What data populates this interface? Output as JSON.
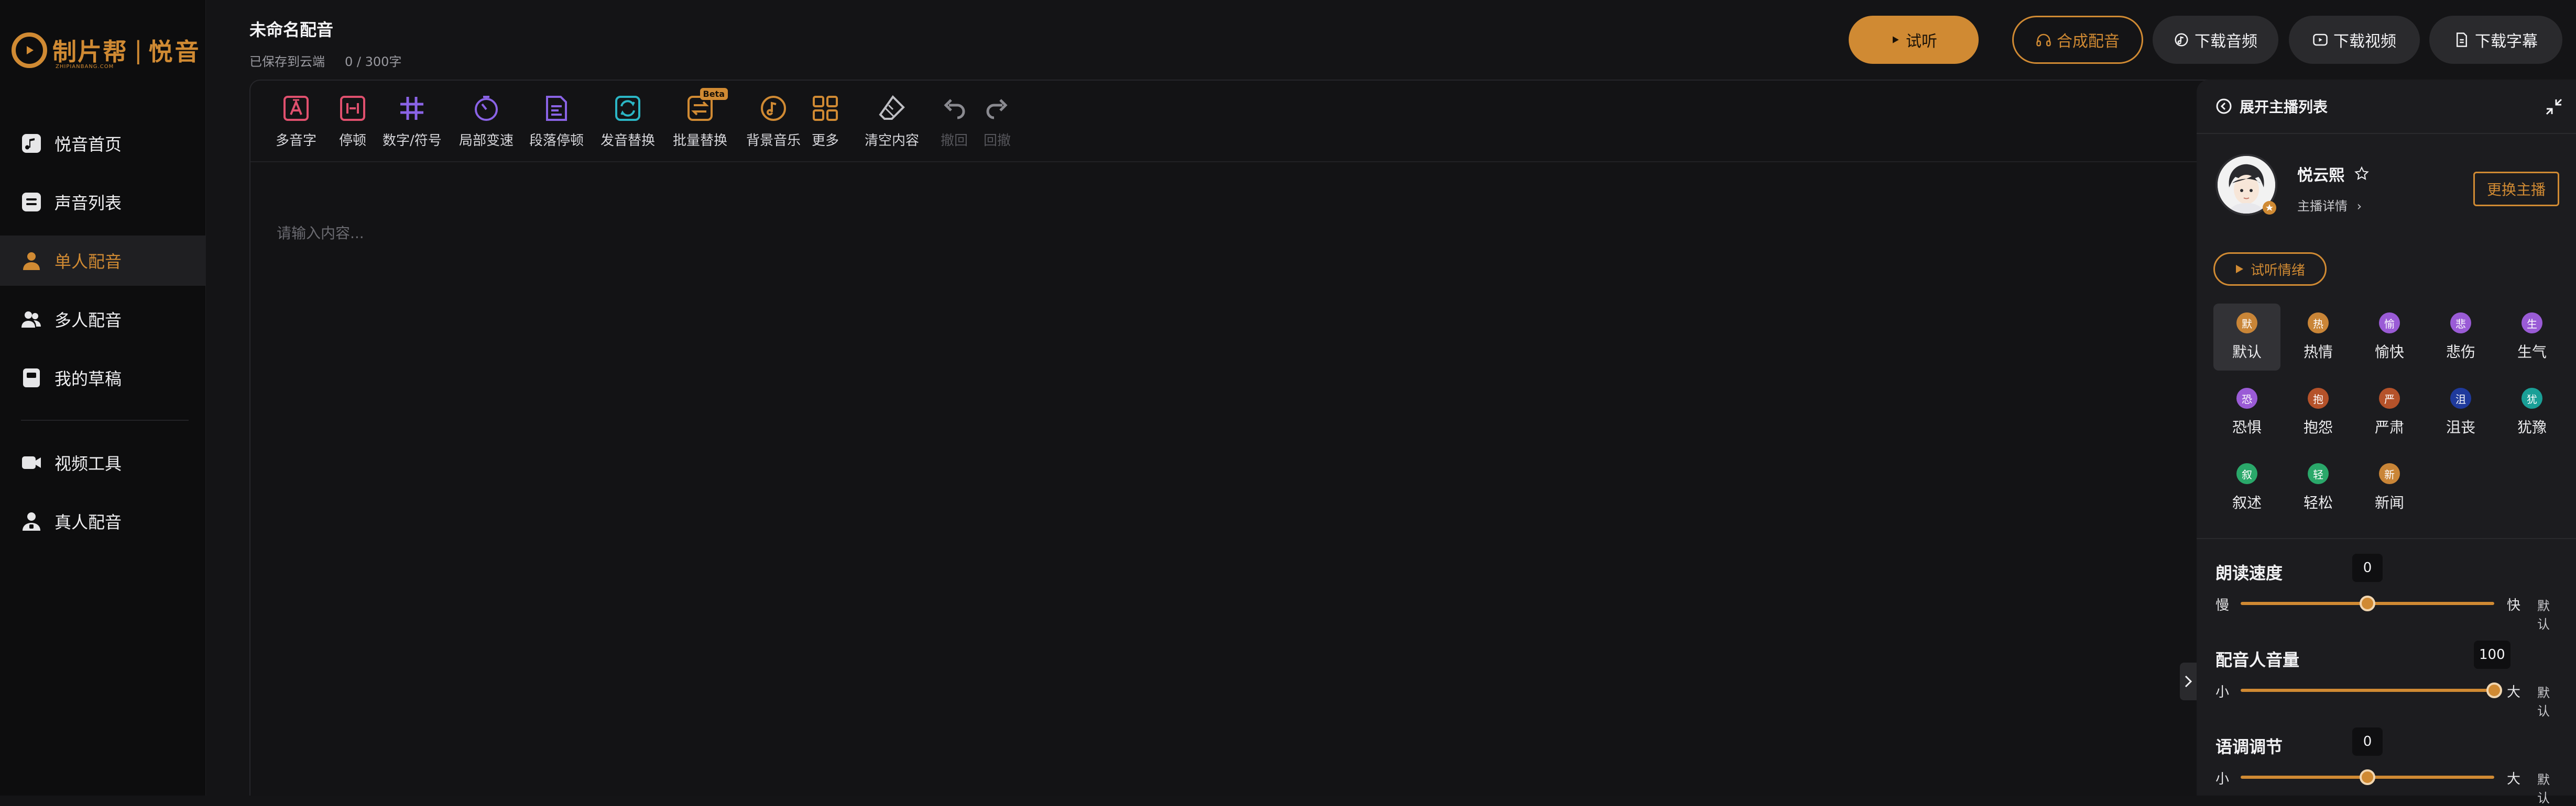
{
  "brand": {
    "name1": "制片帮",
    "name2": "悦音",
    "sub": "ZHIPIANBANG.COM"
  },
  "nav": [
    {
      "label": "悦音首页",
      "icon": "music-note-icon"
    },
    {
      "label": "声音列表",
      "icon": "list-icon"
    },
    {
      "label": "单人配音",
      "icon": "single-user-icon",
      "active": true
    },
    {
      "label": "多人配音",
      "icon": "multi-user-icon"
    },
    {
      "label": "我的草稿",
      "icon": "draft-icon"
    },
    {
      "label": "视频工具",
      "icon": "video-camera-icon"
    },
    {
      "label": "真人配音",
      "icon": "person-voice-icon"
    }
  ],
  "document": {
    "title": "未命名配音",
    "save_status": "已保存到云端",
    "char_count": "0 / 300字"
  },
  "header_buttons": {
    "try": "试听",
    "synthesize": "合成配音",
    "dl_audio": "下载音频",
    "dl_video": "下载视频",
    "dl_subtitle": "下载字幕"
  },
  "toolbar": [
    {
      "label": "多音字",
      "icon": "polyphone-icon"
    },
    {
      "label": "停顿",
      "icon": "pause-icon"
    },
    {
      "label": "数字/符号",
      "icon": "hash-icon"
    },
    {
      "label": "局部变速",
      "icon": "speed-icon"
    },
    {
      "label": "段落停顿",
      "icon": "paragraph-pause-icon"
    },
    {
      "label": "发音替换",
      "icon": "pronounce-replace-icon"
    },
    {
      "label": "批量替换",
      "icon": "batch-replace-icon",
      "badge": "Beta"
    },
    {
      "label": "背景音乐",
      "icon": "bg-music-icon"
    },
    {
      "label": "更多",
      "icon": "grid-more-icon"
    },
    {
      "label": "清空内容",
      "icon": "eraser-icon"
    },
    {
      "label": "撤回",
      "icon": "undo-icon",
      "disabled": true
    },
    {
      "label": "回撤",
      "icon": "redo-icon",
      "disabled": true
    }
  ],
  "editor": {
    "placeholder": "请输入内容..."
  },
  "panel": {
    "expand_label": "展开主播列表",
    "anchor_name": "悦云熙",
    "anchor_detail": "主播详情",
    "change_anchor": "更换主播",
    "try_emotion": "试听情绪",
    "emotions": [
      {
        "glyph": "默",
        "label": "默认",
        "color": "#c98537",
        "active": true
      },
      {
        "glyph": "热",
        "label": "热情",
        "color": "#c98537"
      },
      {
        "glyph": "愉",
        "label": "愉快",
        "color": "#9a5bd6"
      },
      {
        "glyph": "悲",
        "label": "悲伤",
        "color": "#9a5bd6"
      },
      {
        "glyph": "生",
        "label": "生气",
        "color": "#9a5bd6"
      },
      {
        "glyph": "恐",
        "label": "恐惧",
        "color": "#9a5bd6"
      },
      {
        "glyph": "抱",
        "label": "抱怨",
        "color": "#b5522a"
      },
      {
        "glyph": "严",
        "label": "严肃",
        "color": "#b5522a"
      },
      {
        "glyph": "沮",
        "label": "沮丧",
        "color": "#1f3a9c"
      },
      {
        "glyph": "犹",
        "label": "犹豫",
        "color": "#1a9f97"
      },
      {
        "glyph": "叙",
        "label": "叙述",
        "color": "#2aa86a"
      },
      {
        "glyph": "轻",
        "label": "轻松",
        "color": "#2aa86a"
      },
      {
        "glyph": "新",
        "label": "新闻",
        "color": "#c98537"
      }
    ],
    "sliders": [
      {
        "title": "朗读速度",
        "low": "慢",
        "high": "快",
        "default": "默认",
        "value": "0",
        "fraction": 0.5
      },
      {
        "title": "配音人音量",
        "low": "小",
        "high": "大",
        "default": "默认",
        "value": "100",
        "fraction": 1.0
      },
      {
        "title": "语调调节",
        "low": "小",
        "high": "大",
        "default": "默认",
        "value": "0",
        "fraction": 0.5
      }
    ]
  },
  "colors": {
    "accent": "#d08a33",
    "background": "#141416",
    "sidebar": "#0d0d0e",
    "panel": "#1c1c1f"
  }
}
